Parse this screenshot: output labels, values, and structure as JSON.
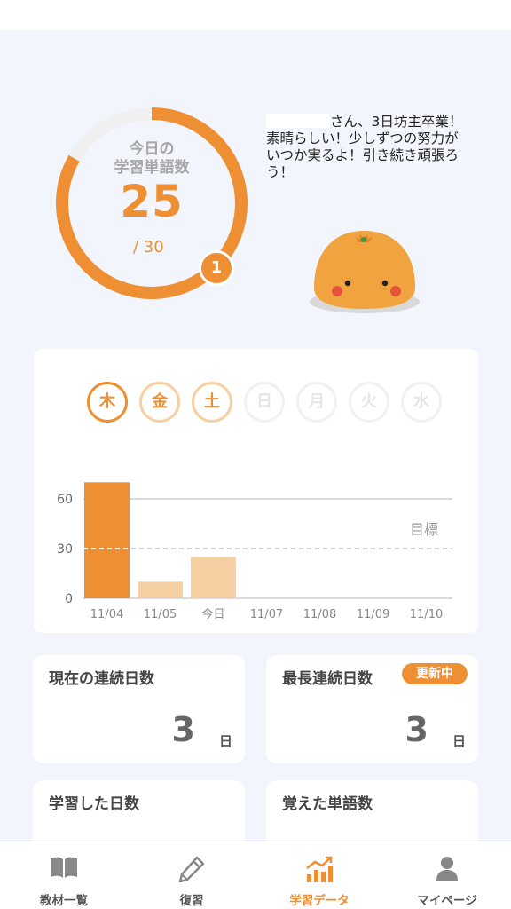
{
  "progress": {
    "label_line1": "今日の",
    "label_line2": "学習単語数",
    "value": "25",
    "goal": "/ 30",
    "fraction": 0.8333,
    "badge": "1"
  },
  "speech": {
    "text": "さん、3日坊主卒業！素晴らしい！少しずつの努力がいつか実るよ！引き続き頑張ろう！"
  },
  "days": [
    {
      "label": "木",
      "state": "active"
    },
    {
      "label": "金",
      "state": "done"
    },
    {
      "label": "土",
      "state": "done"
    },
    {
      "label": "日",
      "state": "future"
    },
    {
      "label": "月",
      "state": "future"
    },
    {
      "label": "火",
      "state": "future"
    },
    {
      "label": "水",
      "state": "future"
    }
  ],
  "chart_data": {
    "type": "bar",
    "categories": [
      "11/04",
      "11/05",
      "今日",
      "11/07",
      "11/08",
      "11/09",
      "11/10"
    ],
    "values": [
      70,
      10,
      25,
      0,
      0,
      0,
      0
    ],
    "yticks": [
      "0",
      "30",
      "60"
    ],
    "ylim": [
      0,
      70
    ],
    "goal_value": 30,
    "goal_label": "目標",
    "colors": {
      "today_strong": "#ee8f33",
      "past": "#f6d0a2",
      "axis": "#bdbdbd",
      "goal_line": "#cccccc"
    }
  },
  "stats": {
    "current_streak": {
      "title": "現在の連続日数",
      "value": "3",
      "unit": "日"
    },
    "longest_streak": {
      "title": "最長連続日数",
      "value": "3",
      "unit": "日",
      "badge": "更新中"
    },
    "days_studied": {
      "title": "学習した日数"
    },
    "words_learned": {
      "title": "覚えた単語数"
    }
  },
  "tabs": [
    {
      "label": "教材一覧",
      "icon": "book-icon",
      "active": false
    },
    {
      "label": "復習",
      "icon": "pencil-icon",
      "active": false
    },
    {
      "label": "学習データ",
      "icon": "chart-icon",
      "active": true
    },
    {
      "label": "マイページ",
      "icon": "person-icon",
      "active": false
    }
  ],
  "colors": {
    "accent": "#ee8f33",
    "background": "#f2f5fb"
  }
}
